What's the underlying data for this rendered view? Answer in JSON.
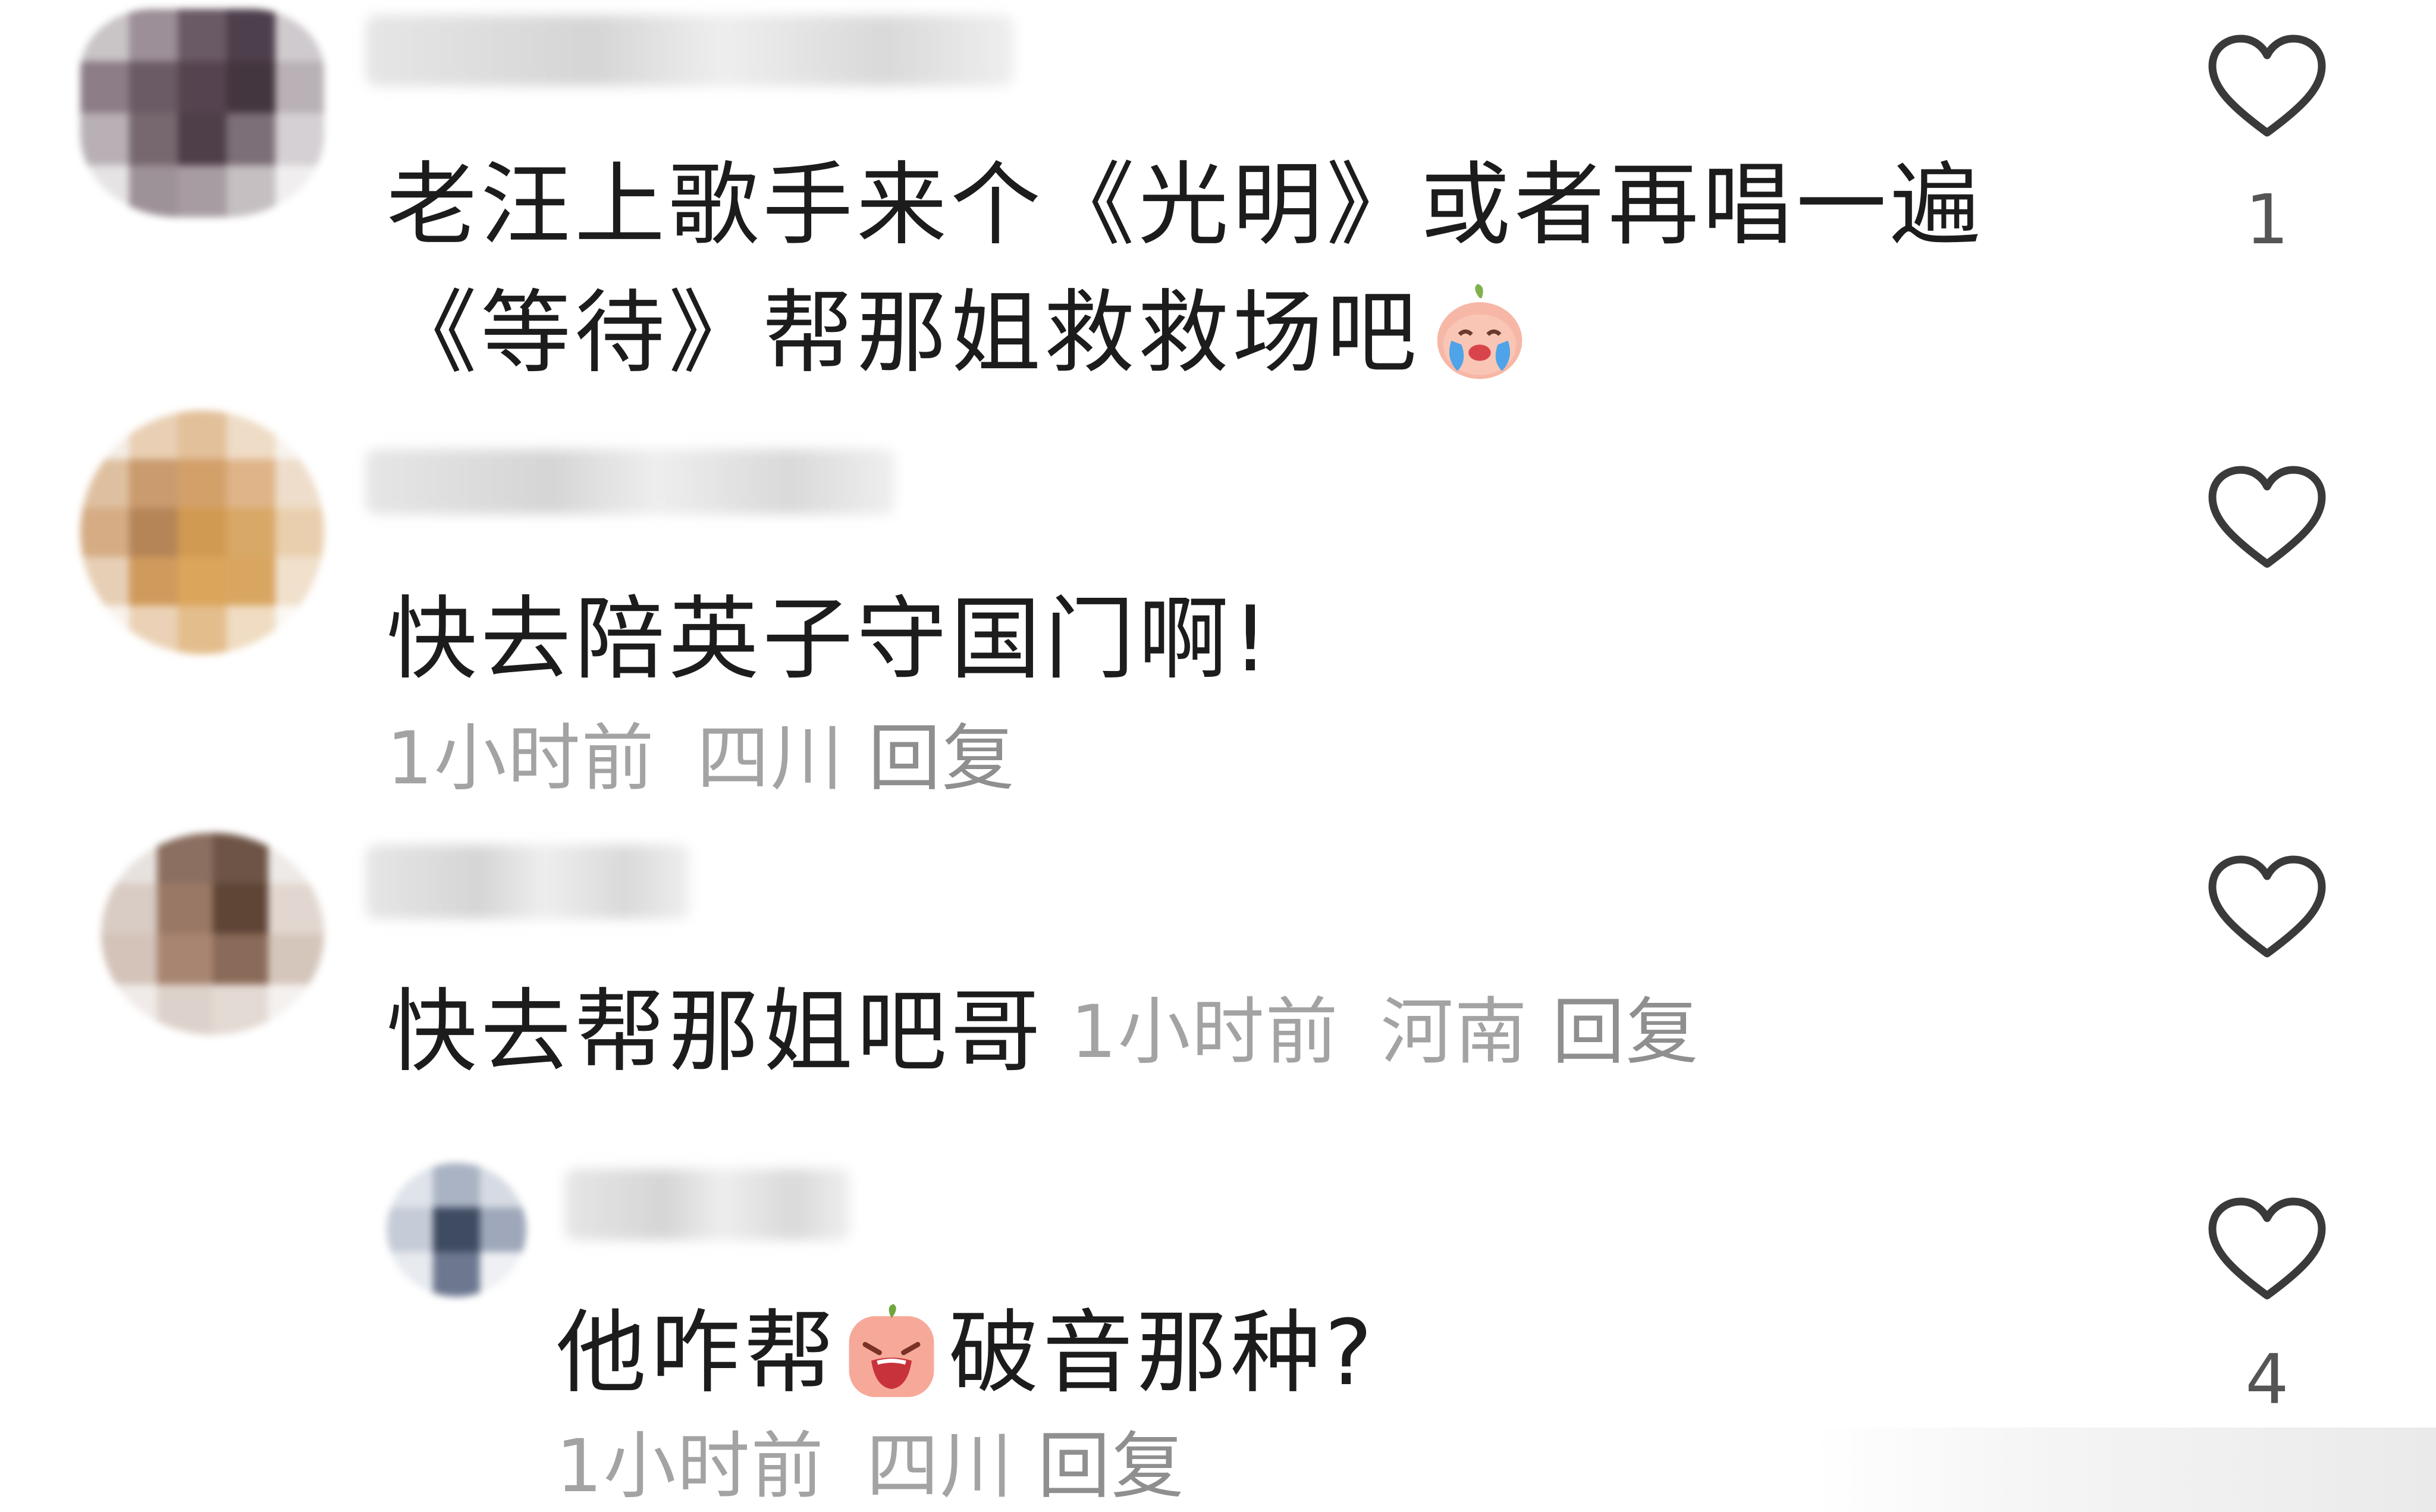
{
  "comments": [
    {
      "text_line1": "老汪上歌手来个《光明》或者再唱一遍",
      "text_line2": "《等待》帮那姐救救场吧",
      "emoji": "crying-peach-emoji",
      "likes": "1"
    },
    {
      "text": "快去陪英子守国门啊!",
      "time": "1小时前",
      "location": "四川",
      "reply_label": "回复"
    },
    {
      "text": "快去帮那姐吧哥",
      "time": "1小时前",
      "location": "河南",
      "reply_label": "回复"
    },
    {
      "text_before": "他咋帮",
      "emoji": "screaming-peach-emoji",
      "text_after": "破音那种?",
      "time": "1小时前",
      "location": "四川",
      "reply_label": "回复",
      "likes": "4"
    }
  ],
  "icons": {
    "like": "heart-outline-icon"
  },
  "colors": {
    "text": "#1c1c1c",
    "meta": "#a3a3a3",
    "heart_stroke": "#3a3a3a",
    "background": "#ffffff"
  }
}
